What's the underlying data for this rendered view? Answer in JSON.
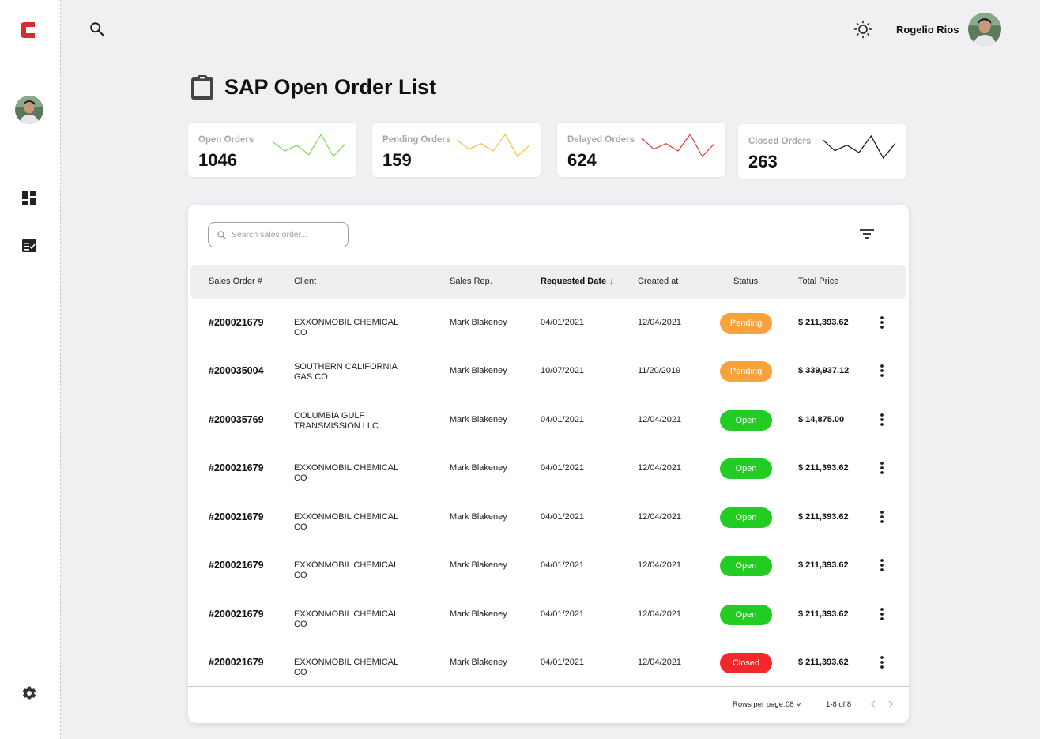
{
  "app": {
    "logo_letter": "C",
    "brand_color": "#d32f2f"
  },
  "topbar": {
    "user_name": "Rogelio Rios"
  },
  "page": {
    "title": "SAP Open Order List"
  },
  "stats": [
    {
      "label": "Open Orders",
      "value": "1046",
      "color": "#7ed957",
      "trend": [
        10,
        5,
        8,
        3,
        14,
        2,
        9
      ]
    },
    {
      "label": "Pending Orders",
      "value": "159",
      "color": "#f6c242",
      "trend": [
        10,
        5,
        8,
        4,
        13,
        1,
        7
      ]
    },
    {
      "label": "Delayed Orders",
      "value": "624",
      "color": "#e53935",
      "trend": [
        11,
        5,
        8,
        4,
        13,
        1,
        8
      ]
    },
    {
      "label": "Closed Orders",
      "value": "263",
      "color": "#111111",
      "trend": [
        11,
        5,
        8,
        4,
        13,
        1,
        9
      ]
    }
  ],
  "search": {
    "placeholder": "Search sales order..."
  },
  "table": {
    "headers": {
      "order": "Sales Order #",
      "client": "Client",
      "rep": "Sales Rep.",
      "requested": "Requested Date",
      "created": "Created at",
      "status": "Status",
      "price": "Total Price"
    },
    "sort_indicator": "↓",
    "rows": [
      {
        "order": "#200021679",
        "client": "EXXONMOBIL CHEMICAL CO",
        "rep": "Mark Blakeney",
        "requested": "04/01/2021",
        "created": "12/04/2021",
        "status": "Pending",
        "price": "$ 211,393.62"
      },
      {
        "order": "#200035004",
        "client": "SOUTHERN CALIFORNIA GAS CO",
        "rep": "Mark Blakeney",
        "requested": "10/07/2021",
        "created": "11/20/2019",
        "status": "Pending",
        "price": "$ 339,937.12"
      },
      {
        "order": "#200035769",
        "client": "COLUMBIA GULF TRANSMISSION LLC",
        "rep": "Mark Blakeney",
        "requested": "04/01/2021",
        "created": "12/04/2021",
        "status": "Open",
        "price": "$ 14,875.00"
      },
      {
        "order": "#200021679",
        "client": "EXXONMOBIL CHEMICAL CO",
        "rep": "Mark Blakeney",
        "requested": "04/01/2021",
        "created": "12/04/2021",
        "status": "Open",
        "price": "$ 211,393.62"
      },
      {
        "order": "#200021679",
        "client": "EXXONMOBIL CHEMICAL CO",
        "rep": "Mark Blakeney",
        "requested": "04/01/2021",
        "created": "12/04/2021",
        "status": "Open",
        "price": "$ 211,393.62"
      },
      {
        "order": "#200021679",
        "client": "EXXONMOBIL CHEMICAL CO",
        "rep": "Mark Blakeney",
        "requested": "04/01/2021",
        "created": "12/04/2021",
        "status": "Open",
        "price": "$ 211,393.62"
      },
      {
        "order": "#200021679",
        "client": "EXXONMOBIL CHEMICAL CO",
        "rep": "Mark Blakeney",
        "requested": "04/01/2021",
        "created": "12/04/2021",
        "status": "Open",
        "price": "$ 211,393.62"
      },
      {
        "order": "#200021679",
        "client": "EXXONMOBIL CHEMICAL CO",
        "rep": "Mark Blakeney",
        "requested": "04/01/2021",
        "created": "12/04/2021",
        "status": "Closed",
        "price": "$ 211,393.62"
      }
    ]
  },
  "status_colors": {
    "Pending": "#f7a23a",
    "Open": "#22cc22",
    "Closed": "#f2282b"
  },
  "pagination": {
    "rows_per_page_label": "Rows per page:",
    "rows_per_page_value": "08",
    "range": "1-8 of 8"
  },
  "icons": [
    "search-icon",
    "sun-icon",
    "dashboard-icon",
    "checklist-icon",
    "gear-icon",
    "clipboard-icon",
    "filter-icon",
    "more-vertical-icon",
    "chevron-left-icon",
    "chevron-right-icon",
    "chevron-down-icon"
  ]
}
